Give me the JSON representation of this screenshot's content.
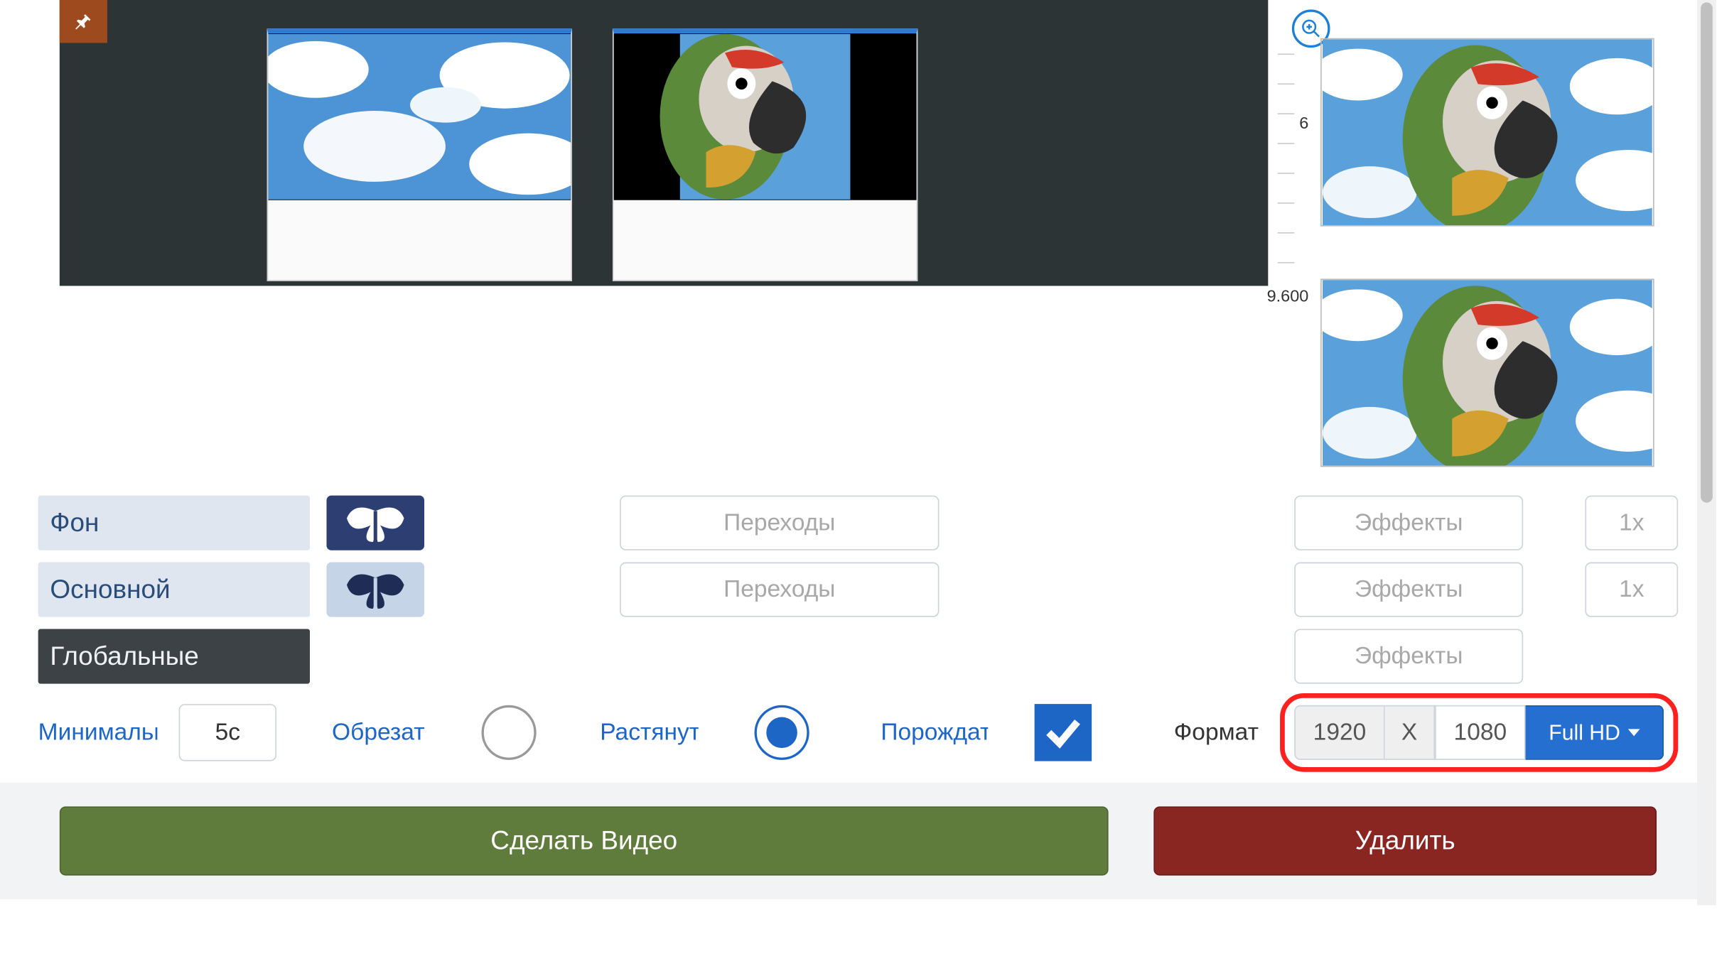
{
  "ruler": {
    "tick1": "6",
    "tick2": "9.600"
  },
  "controls": {
    "background_label": "Фон",
    "main_label": "Основной",
    "global_label": "Глобальные",
    "transitions_label": "Переходы",
    "effects_label": "Эффекты",
    "speed_label": "1x"
  },
  "settings": {
    "minimal_label": "Минимальная",
    "duration_value": "5c",
    "crop_label": "Обрезать",
    "stretch_label": "Растянуть",
    "generate_label": "Порождать",
    "format_label": "Формат",
    "width": "1920",
    "sep": "X",
    "height": "1080",
    "preset": "Full HD"
  },
  "footer": {
    "make_label": "Сделать Видео",
    "delete_label": "Удалить"
  }
}
